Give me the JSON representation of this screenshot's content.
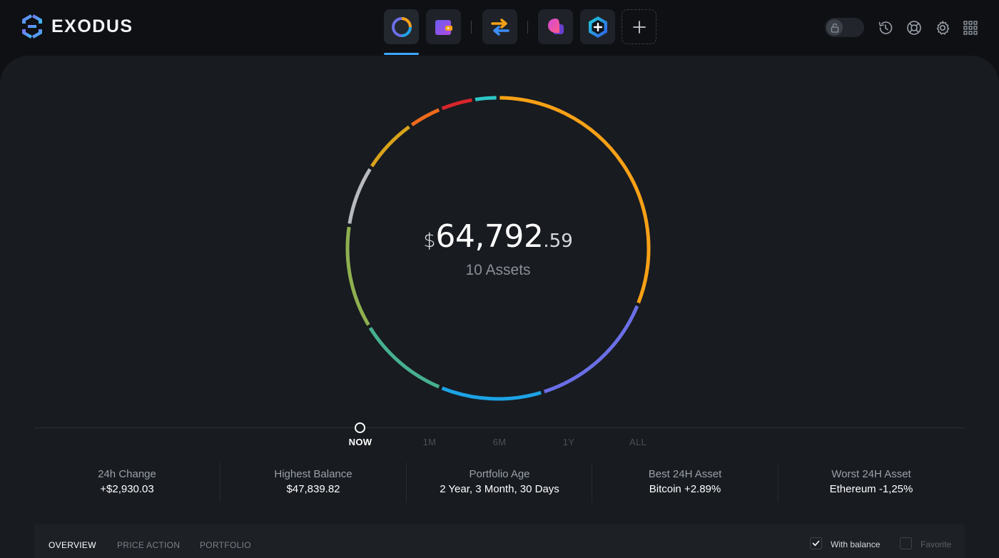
{
  "app": {
    "name": "EXODUS"
  },
  "nav": {
    "items": [
      {
        "name": "portfolio",
        "icon": "portfolio-donut-icon",
        "active": true
      },
      {
        "name": "wallet",
        "icon": "wallet-icon"
      },
      {
        "name": "exchange",
        "icon": "exchange-arrows-icon"
      },
      {
        "name": "apps",
        "icon": "apps-blob-icon"
      },
      {
        "name": "add-app",
        "icon": "hexagon-plus-icon"
      },
      {
        "name": "add",
        "icon": "plus-icon"
      }
    ]
  },
  "toolbar": {
    "lock_icon": "lock-icon",
    "icons": [
      "history-icon",
      "help-lifebuoy-icon",
      "settings-gear-icon",
      "grid-apps-icon"
    ]
  },
  "portfolio": {
    "currency_symbol": "$",
    "balance_main": "64,792",
    "balance_cents": ".59",
    "assets_label": "10 Assets",
    "segments": [
      {
        "fraction": 0.299,
        "color": "#f7a116"
      },
      {
        "fraction": 0.136,
        "color": "#6b6fe6"
      },
      {
        "fraction": 0.106,
        "color": "#1da3e5"
      },
      {
        "fraction": 0.097,
        "color": "#46b08f"
      },
      {
        "fraction": 0.107,
        "color": "#8fb04f"
      },
      {
        "fraction": 0.063,
        "color": "#b8babd"
      },
      {
        "fraction": 0.059,
        "color": "#d9a21b"
      },
      {
        "fraction": 0.035,
        "color": "#ee6a1c"
      },
      {
        "fraction": 0.035,
        "color": "#d8262c"
      },
      {
        "fraction": 0.025,
        "color": "#2ec6c6"
      }
    ]
  },
  "timeline": {
    "ranges": [
      {
        "label": "NOW",
        "active": true
      },
      {
        "label": "1M"
      },
      {
        "label": "6M"
      },
      {
        "label": "1Y"
      },
      {
        "label": "ALL"
      }
    ]
  },
  "stats": [
    {
      "label": "24h Change",
      "value": "+$2,930.03"
    },
    {
      "label": "Highest Balance",
      "value": "$47,839.82"
    },
    {
      "label": "Portfolio Age",
      "value": "2 Year, 3 Month, 30 Days"
    },
    {
      "label": "Best 24H Asset",
      "value": "Bitcoin +2.89%"
    },
    {
      "label": "Worst 24H Asset",
      "value": "Ethereum -1,25%"
    }
  ],
  "tabs": {
    "overview": "OVERVIEW",
    "price_action": "PRICE ACTION",
    "portfolio": "PORTFOLIO",
    "active": "overview"
  },
  "filters": {
    "with_balance": {
      "label": "With balance",
      "checked": true
    },
    "favorite": {
      "label": "Favorite",
      "checked": false
    }
  }
}
